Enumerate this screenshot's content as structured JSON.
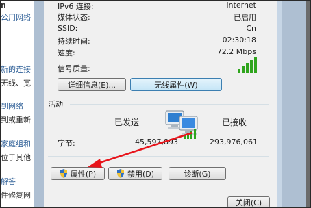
{
  "background_window": {
    "items": [
      {
        "text": "n",
        "kind": "text"
      },
      {
        "text": "公用网络",
        "kind": "link"
      },
      {
        "text": "新的连接",
        "kind": "link"
      },
      {
        "text": "无线、宽",
        "kind": "text"
      },
      {
        "text": "到网络",
        "kind": "link"
      },
      {
        "text": "到或重新",
        "kind": "text"
      },
      {
        "text": "家庭组和",
        "kind": "link"
      },
      {
        "text": "位于其他",
        "kind": "text"
      },
      {
        "text": "解答",
        "kind": "link"
      },
      {
        "text": "件修复网",
        "kind": "text"
      }
    ]
  },
  "connection": {
    "rows": [
      {
        "label": "IPv6 连接:",
        "value": "Internet"
      },
      {
        "label": "媒体状态:",
        "value": "已启用"
      },
      {
        "label": "SSID:",
        "value": "Cn"
      },
      {
        "label": "持续时间:",
        "value": "02:30:18"
      },
      {
        "label": "速度:",
        "value": "72.2 Mbps"
      }
    ],
    "signal_label": "信号质量:",
    "signal_bars_lit": 5,
    "signal_bars_total": 5,
    "details_button": "详细信息(E)...",
    "wireless_props_button": "无线属性(W)"
  },
  "activity": {
    "group_label": "活动",
    "sent_label": "已发送",
    "received_label": "已接收",
    "bytes_label": "字节:",
    "bytes_sent": "45,597,893",
    "bytes_received": "293,976,061"
  },
  "buttons": {
    "properties": "属性(P)",
    "disable": "禁用(D)",
    "diagnose": "诊断(G)",
    "close": "关闭(C)"
  },
  "colors": {
    "annotation_arrow": "#e8141b",
    "signal_green": "#2fa51d",
    "link_blue": "#2e5f97"
  }
}
